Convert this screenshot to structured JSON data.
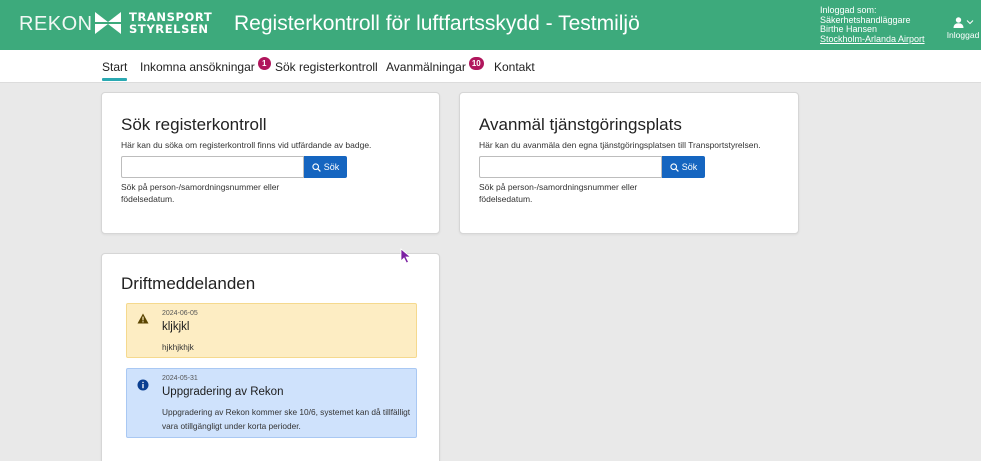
{
  "header": {
    "app_short": "REKON",
    "logo_line1": "TRANSPORT",
    "logo_line2": "STYRELSEN",
    "title": "Registerkontroll för luftfartsskydd - Testmiljö",
    "login_label": "Inloggad som:",
    "role": "Säkerhetshandläggare",
    "user_name": "Birthe Hansen",
    "organization": "Stockholm-Arlanda Airport",
    "user_menu_label": "Inloggad",
    "colors": {
      "header_bg": "#3daa7c",
      "badge": "#b0155c",
      "primary": "#1565c0"
    }
  },
  "nav": {
    "items": [
      {
        "label": "Start",
        "active": true
      },
      {
        "label": "Inkomna ansökningar",
        "badge": "1"
      },
      {
        "label": "Sök registerkontroll"
      },
      {
        "label": "Avanmälningar",
        "badge": "10"
      },
      {
        "label": "Kontakt"
      }
    ]
  },
  "search_card": {
    "title": "Sök registerkontroll",
    "description": "Här kan du söka om registerkontroll finns vid utfärdande av badge.",
    "input_value": "",
    "button_label": "Sök",
    "hint": "Sök på person-/samordningsnummer eller födelsedatum."
  },
  "deregister_card": {
    "title": "Avanmäl tjänstgöringsplats",
    "description": "Här kan du avanmäla den egna tjänstgöringsplatsen till Transportstyrelsen.",
    "input_value": "",
    "button_label": "Sök",
    "hint": "Sök på person-/samordningsnummer eller födelsedatum."
  },
  "operations_card": {
    "title": "Driftmeddelanden",
    "messages": [
      {
        "type": "warning",
        "icon": "warning-icon",
        "date": "2024-06-05",
        "title": "kljkjkl",
        "text": "hjkhjkhjk"
      },
      {
        "type": "info",
        "icon": "info-icon",
        "date": "2024-05-31",
        "title": "Uppgradering av Rekon",
        "text": "Uppgradering av Rekon kommer ske 10/6, systemet kan då tillfälligt vara otillgängligt under korta perioder."
      }
    ]
  }
}
